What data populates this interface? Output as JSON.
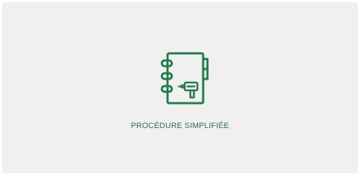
{
  "tile": {
    "label": "PROCÉDURE SIMPLIFIÉE",
    "icon": "notebook-drill-icon"
  },
  "colors": {
    "accent": "#237a4c",
    "label": "#2e6f4a",
    "card_background": "#f0f0f0",
    "page_background": "#ffffff"
  }
}
